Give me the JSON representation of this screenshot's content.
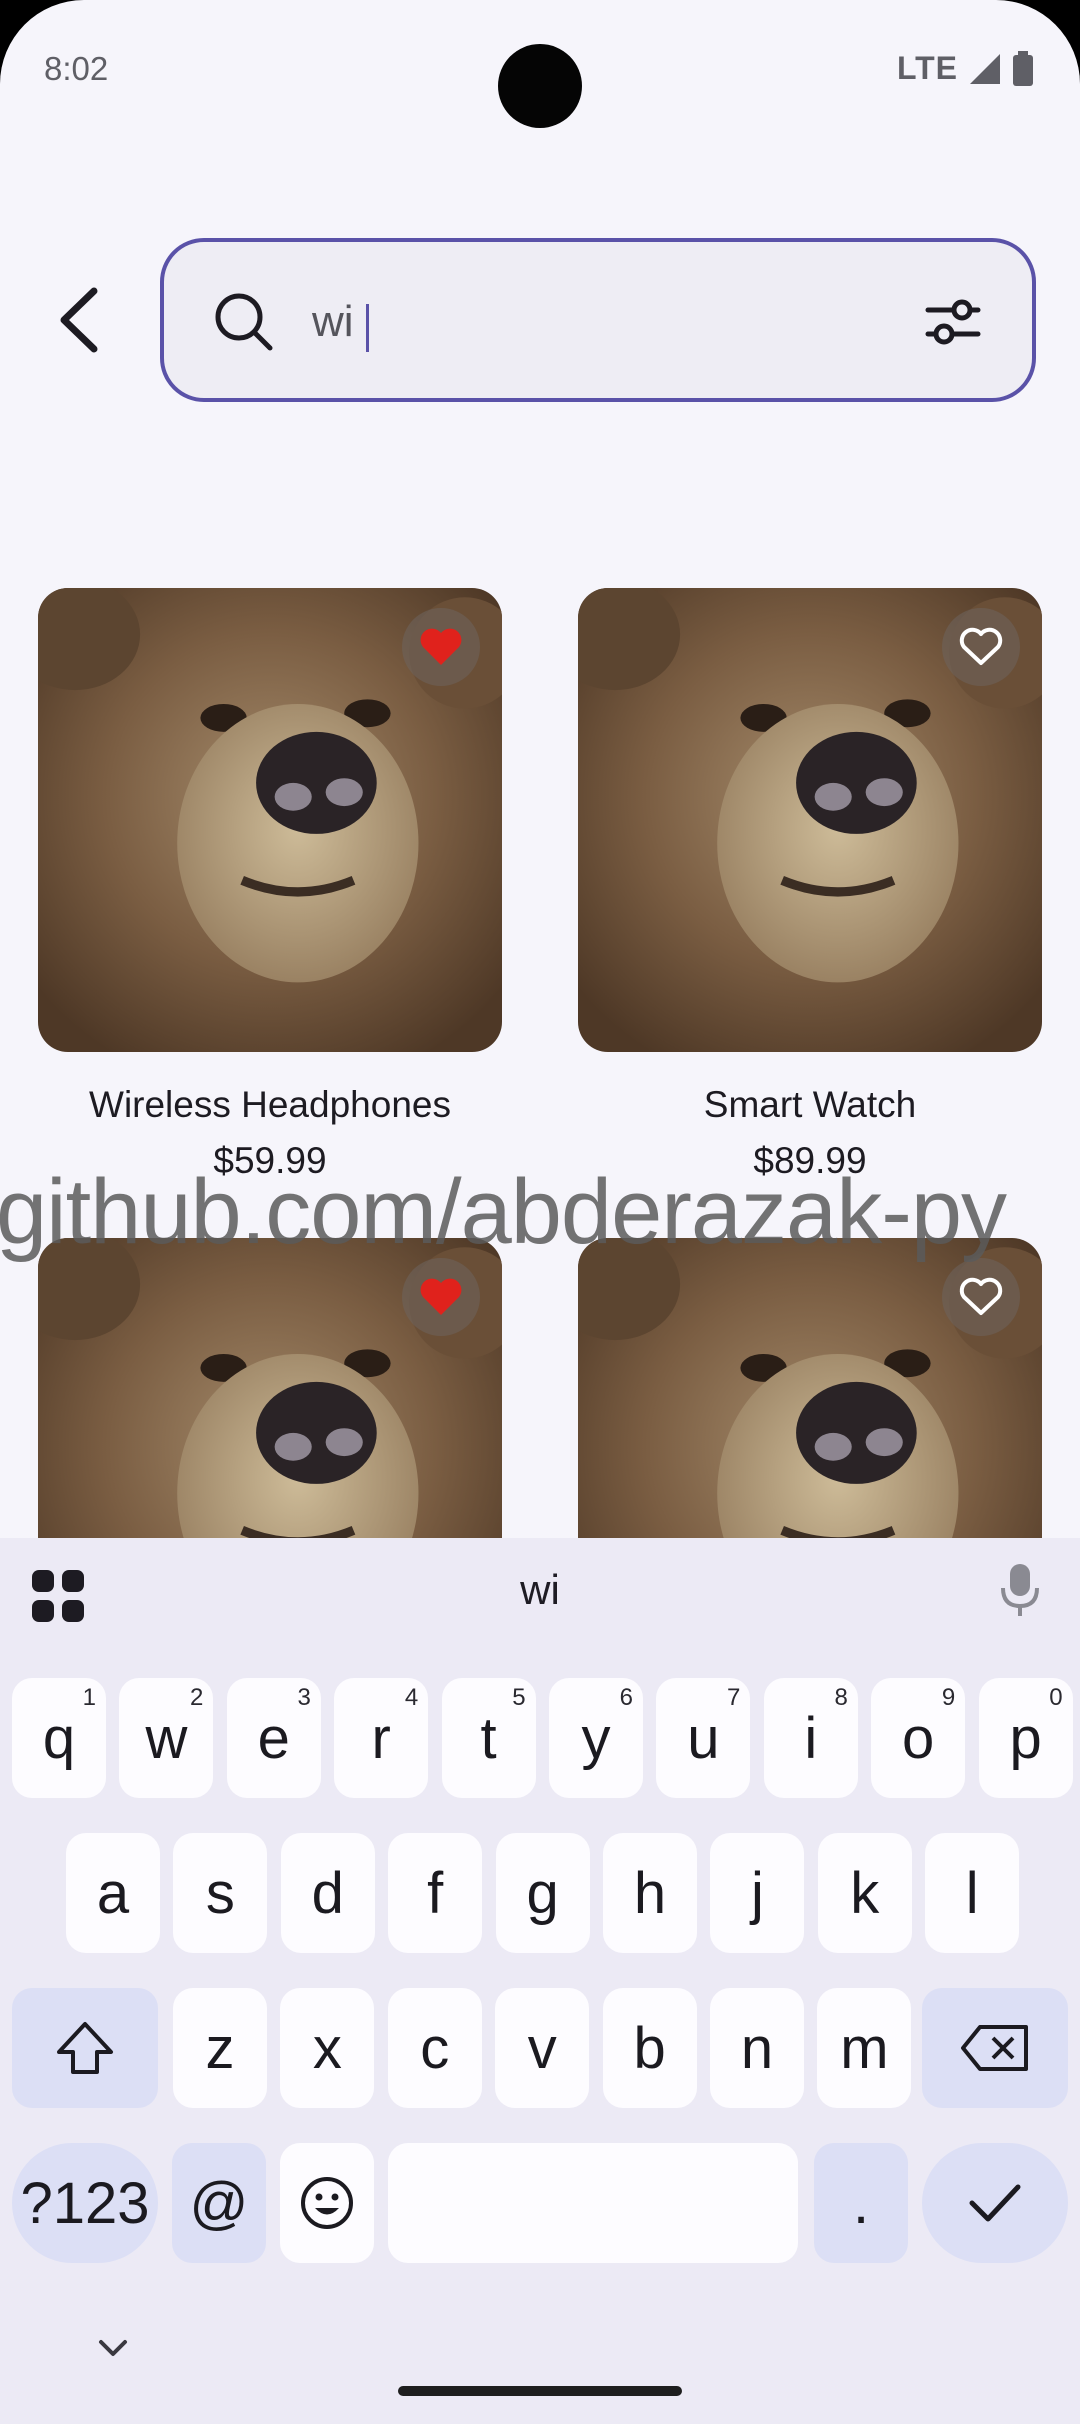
{
  "status_bar": {
    "time": "8:02",
    "network": "LTE"
  },
  "search": {
    "query": "wi",
    "placeholder": ""
  },
  "products": [
    {
      "name": "Wireless Headphones",
      "price": "$59.99",
      "favorited": true
    },
    {
      "name": "Smart Watch",
      "price": "$89.99",
      "favorited": false
    },
    {
      "name": "",
      "price": "",
      "favorited": true
    },
    {
      "name": "",
      "price": "",
      "favorited": false
    }
  ],
  "watermark": "github.com/abderazak-py",
  "keyboard": {
    "suggestion": "wi",
    "row1": [
      {
        "key": "q",
        "hint": "1"
      },
      {
        "key": "w",
        "hint": "2"
      },
      {
        "key": "e",
        "hint": "3"
      },
      {
        "key": "r",
        "hint": "4"
      },
      {
        "key": "t",
        "hint": "5"
      },
      {
        "key": "y",
        "hint": "6"
      },
      {
        "key": "u",
        "hint": "7"
      },
      {
        "key": "i",
        "hint": "8"
      },
      {
        "key": "o",
        "hint": "9"
      },
      {
        "key": "p",
        "hint": "0"
      }
    ],
    "row2": [
      "a",
      "s",
      "d",
      "f",
      "g",
      "h",
      "j",
      "k",
      "l"
    ],
    "row3": [
      "z",
      "x",
      "c",
      "v",
      "b",
      "n",
      "m"
    ],
    "symbols_label": "?123",
    "at_label": "@",
    "period_label": "."
  },
  "colors": {
    "accent": "#5a52a8",
    "favorite": "#e0221c",
    "keyboard_bg": "#eceaf5"
  }
}
